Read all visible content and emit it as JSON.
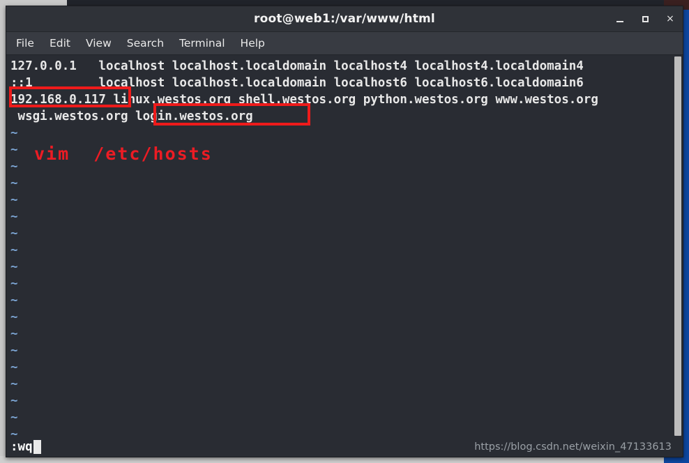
{
  "window": {
    "title": "root@web1:/var/www/html",
    "controls": {
      "minimize": "minimize-button",
      "maximize": "maximize-button",
      "close": "×"
    }
  },
  "menubar": {
    "items": [
      {
        "label": "File"
      },
      {
        "label": "Edit"
      },
      {
        "label": "View"
      },
      {
        "label": "Search"
      },
      {
        "label": "Terminal"
      },
      {
        "label": "Help"
      }
    ]
  },
  "terminal": {
    "editor": "vim",
    "file": "/etc/hosts",
    "lines": [
      "127.0.0.1   localhost localhost.localdomain localhost4 localhost4.localdomain4",
      "::1         localhost localhost.localdomain localhost6 localhost6.localdomain6",
      "192.168.0.117 linux.westos.org shell.westos.org python.westos.org www.westos.org",
      " wsgi.westos.org login.westos.org"
    ],
    "empty_line_marker": "~",
    "empty_line_count": 20
  },
  "annotations": {
    "command_note": "vim  /etc/hosts",
    "highlight_ip": "192.168.0.117",
    "highlight_host": "login.westos.org",
    "box_color": "#ee1b1b",
    "text_color": "#ec1c24"
  },
  "statusbar": {
    "command": ":wq",
    "cursor": "block",
    "watermark": "https://blog.csdn.net/weixin_47133613"
  }
}
